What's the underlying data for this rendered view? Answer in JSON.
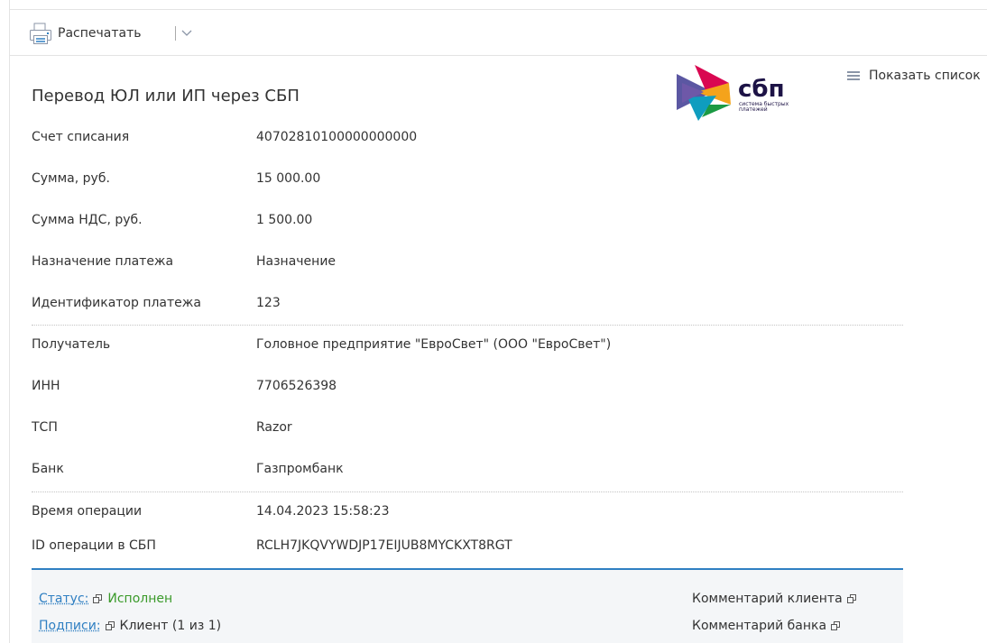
{
  "toolbar": {
    "print_label": "Распечатать",
    "icons": [
      "printer-icon",
      "chevron-down-icon"
    ]
  },
  "header": {
    "title": "Перевод ЮЛ или ИП через СБП",
    "show_list_label": "Показать список",
    "logo": {
      "name": "сбп",
      "caption_line1": "система быстрых",
      "caption_line2": "платежей"
    }
  },
  "details": {
    "rows": [
      {
        "label": "Счет списания",
        "value": "40702810100000000000"
      },
      {
        "label": "Сумма, руб.",
        "value": "15 000.00"
      },
      {
        "label": "Сумма НДС, руб.",
        "value": "1 500.00"
      },
      {
        "label": "Назначение платежа",
        "value": "Назначение"
      },
      {
        "label": "Идентификатор платежа",
        "value": "123"
      },
      {
        "label": "Получатель",
        "value": "Головное предприятие \"ЕвроСвет\" (ООО \"ЕвроСвет\")"
      },
      {
        "label": "ИНН",
        "value": "7706526398"
      },
      {
        "label": "ТСП",
        "value": "Razor"
      },
      {
        "label": "Банк",
        "value": "Газпромбанк"
      },
      {
        "label": "Время операции",
        "value": "14.04.2023 15:58:23"
      },
      {
        "label": "ID операции в СБП",
        "value": "RCLH7JKQVYWDJP17EIJUB8MYCKXT8RGT"
      }
    ]
  },
  "footer": {
    "status_label": "Статус:",
    "status_value": "Исполнен",
    "signatures_label": "Подписи:",
    "signatures_value": "Клиент (1 из 1)",
    "client_comment": "Комментарий клиента",
    "bank_comment": "Комментарий банка"
  },
  "colors": {
    "link": "#2f7fc2",
    "status_ok": "#3a9a2a",
    "footer_bg": "#f4f6f8",
    "footer_border": "#2f7fc2",
    "logo_text": "#1d1346"
  }
}
